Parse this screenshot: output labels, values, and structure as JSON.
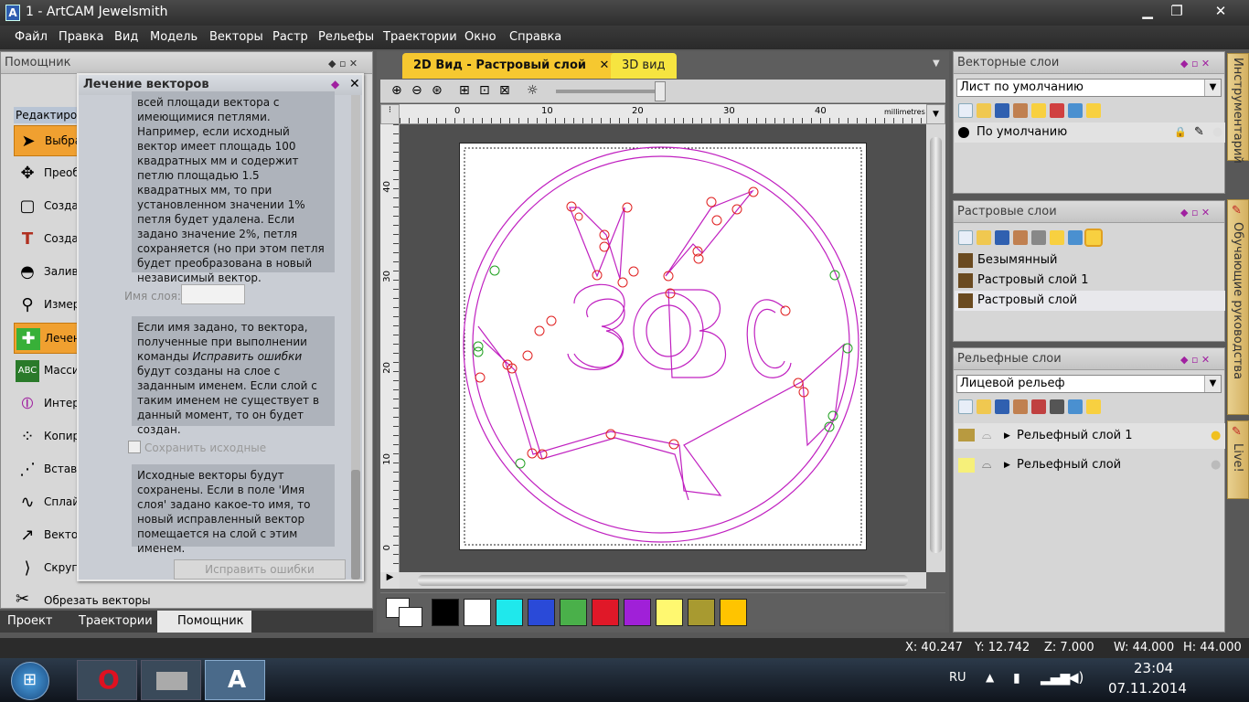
{
  "app": {
    "title": "1 - ArtCAM Jewelsmith"
  },
  "menu": [
    "Файл",
    "Правка",
    "Вид",
    "Модель",
    "Векторы",
    "Растр",
    "Рельефы",
    "Траектории",
    "Окно",
    "Справка"
  ],
  "helper": {
    "title": "Помощник",
    "section": "Редактиров",
    "tools": [
      "Выбра",
      "Преоб",
      "Созда",
      "Созда",
      "Залив",
      "Измер",
      "Лечен",
      "Масси",
      "Интер",
      "Копир",
      "Встави",
      "Сплай",
      "Вектор",
      "Скругл"
    ],
    "last_tool": "Обрезать векторы",
    "tabs": [
      "Проект",
      "Траектории",
      "Помощник"
    ]
  },
  "fixdialog": {
    "title": "Лечение векторов",
    "info1": "всей площади вектора с имеющимися петлями. Например, если исходный вектор имеет площадь 100 квадратных мм и содержит петлю площадью 1.5 квадратных мм, то при установленном значении 1% петля будет удалена. Если задано значение 2%, петля сохраняется (но при этом петля будет преобразована в новый независимый вектор.",
    "layer_label": "Имя слоя:",
    "layer_value": "",
    "info2_a": "Если имя задано, то вектора, полученные при выполнении команды ",
    "info2_em": "Исправить ошибки",
    "info2_b": " будут созданы на слое с заданным именем. Если слой с таким именем не существует в данный момент, то он будет создан.",
    "keep_label": "Сохранить исходные",
    "info3": "Исходные векторы будут сохранены. Если в поле 'Имя слоя' задано какое-то имя, то новый исправленный вектор помещается на слой с этим именем.",
    "fix_button": "Исправить ошибки"
  },
  "doc": {
    "tab_2d": "2D Вид - Растровый слой",
    "tab_3d": "3D вид",
    "ruler_unit": "millimetres",
    "ruler_top": [
      "0",
      "10",
      "20",
      "30",
      "40"
    ],
    "ruler_left": [
      "40",
      "30",
      "20",
      "10",
      "0"
    ],
    "palette": [
      "#000000",
      "#ffffff",
      "#1fe8ec",
      "#2a4ad8",
      "#4ab04a",
      "#e01828",
      "#a020d8",
      "#fff870",
      "#a89a30",
      "#ffc400"
    ]
  },
  "vector_layers": {
    "title": "Векторные слои",
    "combo": "Лист по умолчанию",
    "layer": "По умолчанию"
  },
  "raster_layers": {
    "title": "Растровые слои",
    "layers": [
      "Безымянный",
      "Растровый слой 1",
      "Растровый слой"
    ]
  },
  "relief_layers": {
    "title": "Рельефные слои",
    "combo": "Лицевой рельеф",
    "layers": [
      "Рельефный слой 1",
      "Рельефный слой"
    ]
  },
  "side_tabs": [
    "Инструментарий",
    "Обучающие руководства",
    "Live!"
  ],
  "status": {
    "x": "X: 40.247",
    "y": "Y: 12.742",
    "z": "Z: 7.000",
    "w": "W: 44.000",
    "h": "H: 44.000"
  },
  "taskbar": {
    "lang": "RU",
    "time": "23:04",
    "date": "07.11.2014"
  }
}
